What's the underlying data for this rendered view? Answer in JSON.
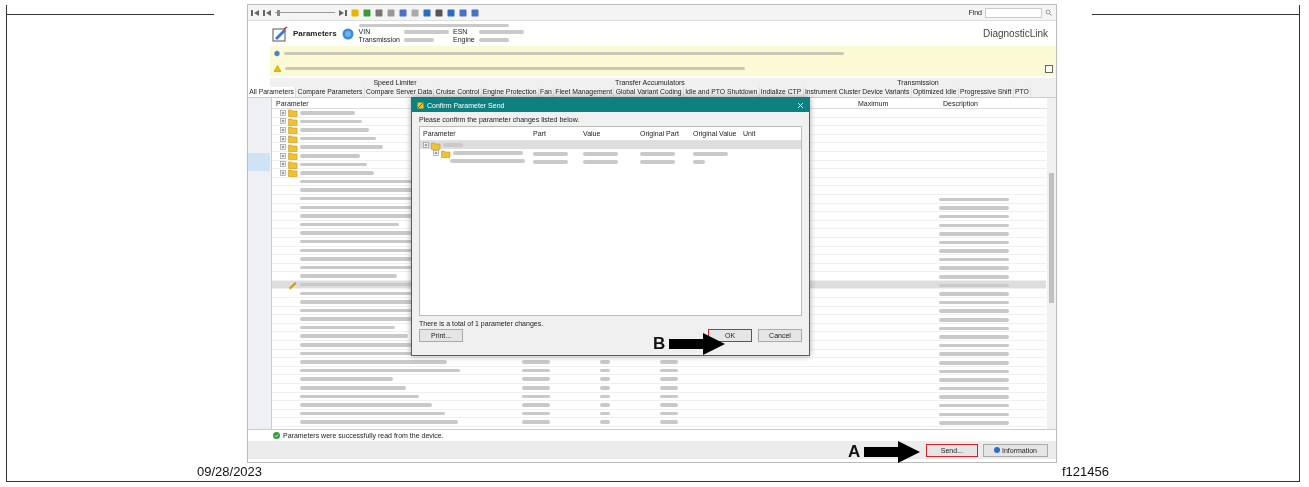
{
  "toolbar": {
    "find_label": "Find",
    "timeline": {
      "level": 0.05
    }
  },
  "header": {
    "title": "Parameters",
    "fields": [
      "VIN",
      "ESN",
      "Transmission",
      "Engine"
    ],
    "logo": "DiagnosticLink"
  },
  "tab_groups": [
    "Speed Limiter",
    "Transfer Accumulators",
    "Transmission"
  ],
  "tabs": [
    {
      "label": "All Parameters",
      "selected": true
    },
    {
      "label": "Compare Parameters",
      "selected": false
    },
    {
      "label": "Compare Server Data",
      "selected": false
    },
    {
      "label": "Cruise Control",
      "selected": false
    },
    {
      "label": "Engine Protection",
      "selected": false
    },
    {
      "label": "Fan",
      "selected": false
    },
    {
      "label": "Fleet Management",
      "selected": false
    },
    {
      "label": "Global Variant Coding",
      "selected": false
    },
    {
      "label": "Idle and PTO Shutdown",
      "selected": false
    },
    {
      "label": "Indialize CTP",
      "selected": false
    },
    {
      "label": "Instrument Cluster Device Variants",
      "selected": false
    },
    {
      "label": "Optimized Idle",
      "selected": false
    },
    {
      "label": "Progressive Shift",
      "selected": false
    },
    {
      "label": "PTO",
      "selected": false
    }
  ],
  "grid": {
    "columns": [
      "Parameter",
      "Maximum",
      "Description"
    ]
  },
  "dialog": {
    "title": "Confirm Parameter Send",
    "prompt": "Please confirm the parameter changes listed below.",
    "columns": [
      "Parameter",
      "Part",
      "Value",
      "Original Part",
      "Original Value",
      "Unit"
    ],
    "summary": "There is a total of 1 parameter changes.",
    "buttons": [
      {
        "label": "Print...",
        "highlighted": false
      },
      {
        "label": "OK",
        "highlighted": true
      },
      {
        "label": "Cancel",
        "highlighted": false
      }
    ]
  },
  "status": "Parameters were successfully read from the device.",
  "bottom_buttons": [
    {
      "kind": "button",
      "label": "Send...",
      "highlighted": true
    },
    {
      "kind": "info",
      "label": "Information",
      "highlighted": false
    }
  ],
  "callouts": [
    "B",
    "A"
  ],
  "footer": {
    "date": "09/28/2023",
    "figure": "f121456"
  }
}
